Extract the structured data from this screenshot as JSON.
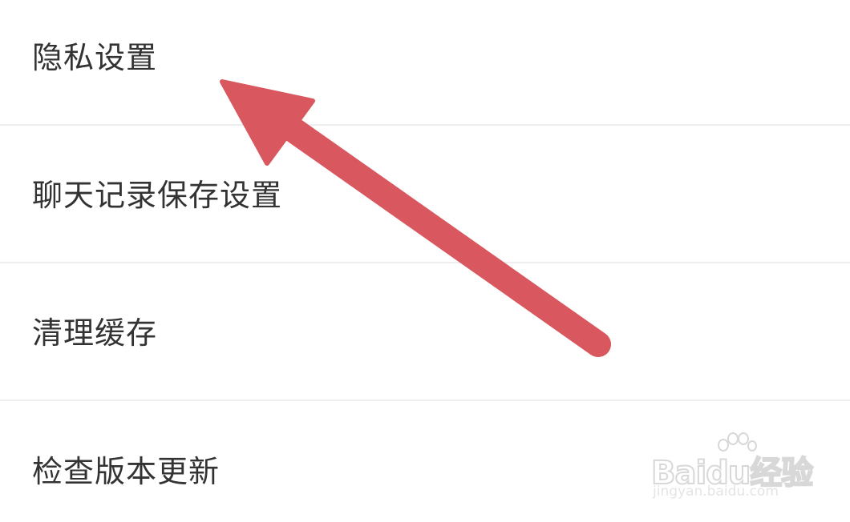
{
  "settings": {
    "items": [
      {
        "label": "隐私设置"
      },
      {
        "label": "聊天记录保存设置"
      },
      {
        "label": "清理缓存"
      },
      {
        "label": "检查版本更新"
      }
    ]
  },
  "annotation": {
    "icon": "arrow-up-left-icon",
    "color": "#d9575e"
  },
  "watermark": {
    "logo_text": "Baidu经验",
    "url": "jingyan.baidu.com"
  }
}
